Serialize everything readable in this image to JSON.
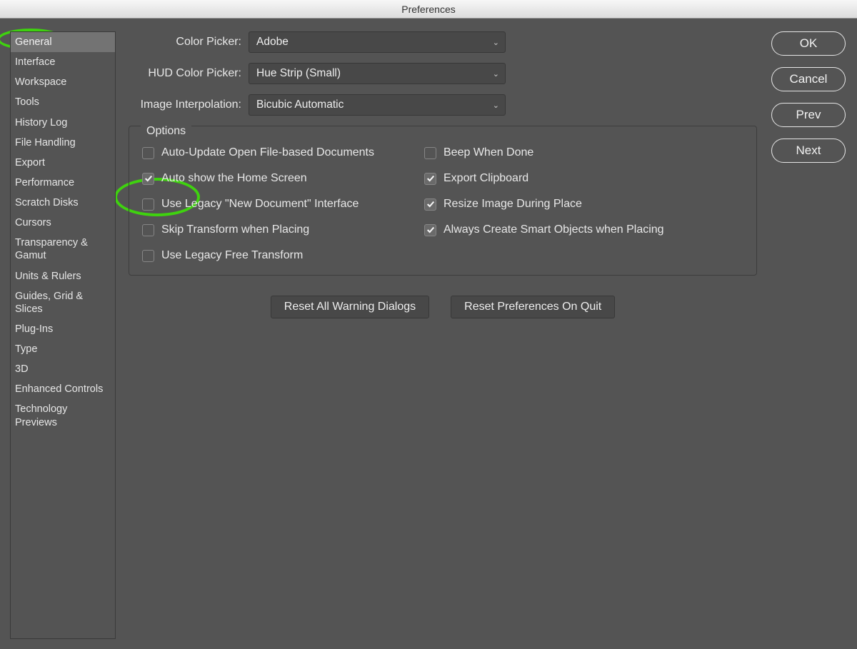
{
  "window": {
    "title": "Preferences"
  },
  "sidebar": {
    "items": [
      {
        "label": "General",
        "selected": true
      },
      {
        "label": "Interface"
      },
      {
        "label": "Workspace"
      },
      {
        "label": "Tools"
      },
      {
        "label": "History Log"
      },
      {
        "label": "File Handling"
      },
      {
        "label": "Export"
      },
      {
        "label": "Performance"
      },
      {
        "label": "Scratch Disks"
      },
      {
        "label": "Cursors"
      },
      {
        "label": "Transparency & Gamut"
      },
      {
        "label": "Units & Rulers"
      },
      {
        "label": "Guides, Grid & Slices"
      },
      {
        "label": "Plug-Ins"
      },
      {
        "label": "Type"
      },
      {
        "label": "3D"
      },
      {
        "label": "Enhanced Controls"
      },
      {
        "label": "Technology Previews"
      }
    ]
  },
  "form": {
    "color_picker": {
      "label": "Color Picker:",
      "value": "Adobe"
    },
    "hud_color_picker": {
      "label": "HUD Color Picker:",
      "value": "Hue Strip (Small)"
    },
    "image_interpolation": {
      "label": "Image Interpolation:",
      "value": "Bicubic Automatic"
    }
  },
  "options": {
    "legend": "Options",
    "left": [
      {
        "label": "Auto-Update Open File-based Documents",
        "checked": false
      },
      {
        "label": "Auto show the Home Screen",
        "checked": true
      },
      {
        "label": "Use Legacy \"New Document\" Interface",
        "checked": false
      },
      {
        "label": "Skip Transform when Placing",
        "checked": false
      },
      {
        "label": "Use Legacy Free Transform",
        "checked": false
      }
    ],
    "right": [
      {
        "label": "Beep When Done",
        "checked": false
      },
      {
        "label": "Export Clipboard",
        "checked": true
      },
      {
        "label": "Resize Image During Place",
        "checked": true
      },
      {
        "label": "Always Create Smart Objects when Placing",
        "checked": true
      }
    ]
  },
  "bottom_buttons": {
    "reset_warnings": "Reset All Warning Dialogs",
    "reset_prefs": "Reset Preferences On Quit"
  },
  "right_buttons": {
    "ok": "OK",
    "cancel": "Cancel",
    "prev": "Prev",
    "next": "Next"
  }
}
